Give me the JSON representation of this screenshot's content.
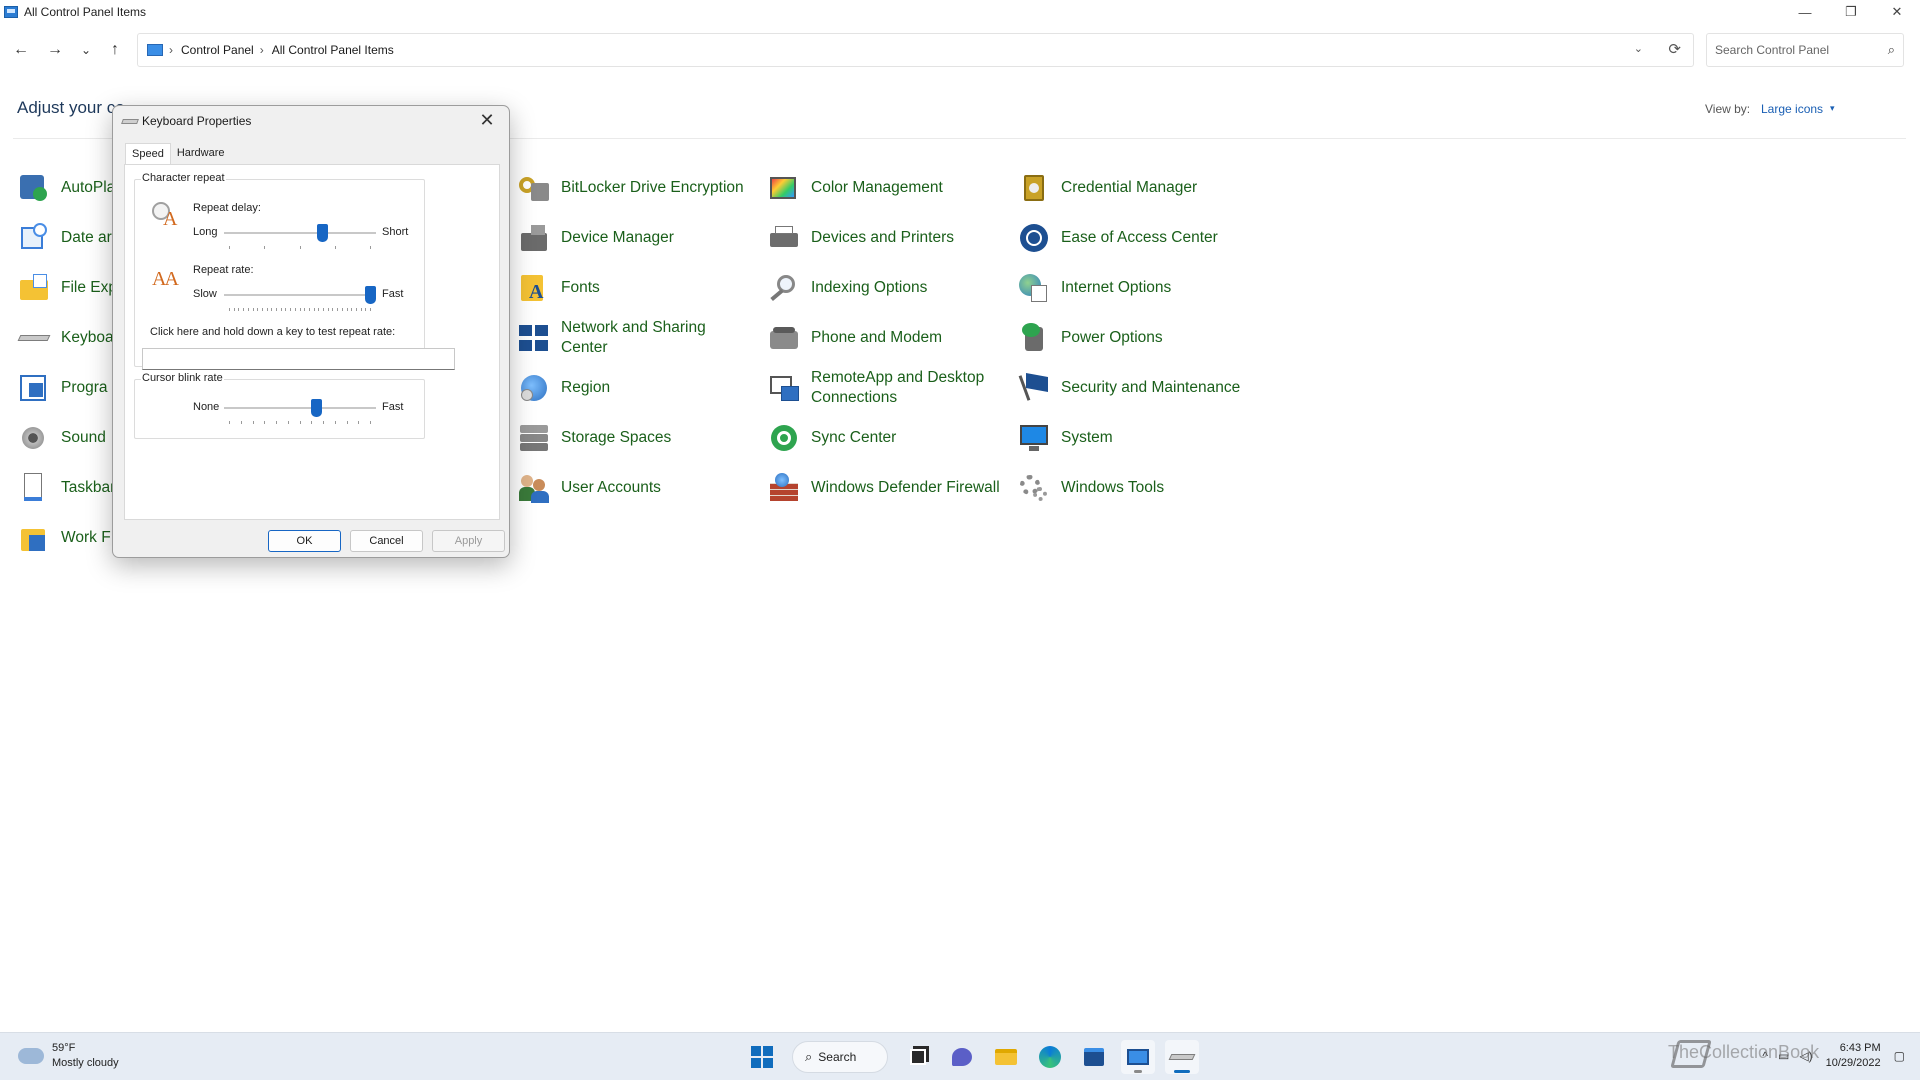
{
  "window": {
    "title": "All Control Panel Items",
    "controls": {
      "minimize": "—",
      "restore": "❐",
      "close": "✕"
    }
  },
  "nav": {
    "back": "←",
    "forward": "→",
    "recent": "⌄",
    "up": "↑",
    "breadcrumb": [
      "Control Panel",
      "All Control Panel Items"
    ],
    "separator": "›",
    "dropdown": "⌄",
    "refresh": "⟳",
    "search_placeholder": "Search Control Panel",
    "search_icon": "⌕"
  },
  "content": {
    "heading": "Adjust your co",
    "view_by_label": "View by:",
    "view_by_value": "Large icons",
    "view_by_caret": "▾",
    "items_col1": [
      {
        "label": "AutoPla",
        "icon": "autoplay-icon"
      },
      {
        "label": "Date ar",
        "icon": "date-time-icon"
      },
      {
        "label": "File Exp",
        "icon": "file-explorer-icon"
      },
      {
        "label": "Keyboa",
        "icon": "keyboard-icon"
      },
      {
        "label": "Progra",
        "icon": "programs-icon"
      },
      {
        "label": "Sound",
        "icon": "sound-icon"
      },
      {
        "label": "Taskbar",
        "icon": "taskbar-icon"
      },
      {
        "label": "Work F",
        "icon": "work-folders-icon"
      }
    ],
    "items_col2": [
      {
        "label": "BitLocker Drive Encryption",
        "icon": "bitlocker-icon"
      },
      {
        "label": "Device Manager",
        "icon": "device-manager-icon"
      },
      {
        "label": "Fonts",
        "icon": "fonts-icon"
      },
      {
        "label": "Network and Sharing Center",
        "icon": "network-icon"
      },
      {
        "label": "Region",
        "icon": "region-icon"
      },
      {
        "label": "Storage Spaces",
        "icon": "storage-spaces-icon"
      },
      {
        "label": "User Accounts",
        "icon": "user-accounts-icon"
      }
    ],
    "items_col3": [
      {
        "label": "Color Management",
        "icon": "color-management-icon"
      },
      {
        "label": "Devices and Printers",
        "icon": "devices-printers-icon"
      },
      {
        "label": "Indexing Options",
        "icon": "indexing-icon"
      },
      {
        "label": "Phone and Modem",
        "icon": "phone-modem-icon"
      },
      {
        "label": "RemoteApp and Desktop Connections",
        "icon": "remoteapp-icon"
      },
      {
        "label": "Sync Center",
        "icon": "sync-center-icon"
      },
      {
        "label": "Windows Defender Firewall",
        "icon": "firewall-icon"
      }
    ],
    "items_col4": [
      {
        "label": "Credential Manager",
        "icon": "credential-manager-icon"
      },
      {
        "label": "Ease of Access Center",
        "icon": "ease-of-access-icon"
      },
      {
        "label": "Internet Options",
        "icon": "internet-options-icon"
      },
      {
        "label": "Power Options",
        "icon": "power-options-icon"
      },
      {
        "label": "Security and Maintenance",
        "icon": "security-flag-icon"
      },
      {
        "label": "System",
        "icon": "system-icon"
      },
      {
        "label": "Windows Tools",
        "icon": "windows-tools-icon"
      }
    ]
  },
  "dialog": {
    "title": "Keyboard Properties",
    "close": "✕",
    "tabs": [
      "Speed",
      "Hardware"
    ],
    "active_tab": "Speed",
    "character_repeat": {
      "group_title": "Character repeat",
      "delay_label": "Repeat delay:",
      "delay_min": "Long",
      "delay_max": "Short",
      "delay_value": 0.66,
      "rate_label": "Repeat rate:",
      "rate_min": "Slow",
      "rate_max": "Fast",
      "rate_value": 1.0,
      "test_label": "Click here and hold down a key to test repeat rate:",
      "test_value": ""
    },
    "cursor_blink": {
      "group_title": "Cursor blink rate",
      "min": "None",
      "max": "Fast",
      "value": 0.62
    },
    "buttons": {
      "ok": "OK",
      "cancel": "Cancel",
      "apply": "Apply"
    }
  },
  "taskbar": {
    "weather_temp": "59°F",
    "weather_desc": "Mostly cloudy",
    "search_label": "Search",
    "search_glyph": "⌕",
    "apps": [
      "windows-start-icon",
      "task-view-icon",
      "teams-chat-icon",
      "file-explorer-icon",
      "edge-icon",
      "store-icon",
      "control-panel-icon",
      "keyboard-app-icon"
    ],
    "tray_chevron": "^",
    "tray_network": "▭",
    "tray_volume": "◁)",
    "time": "6:43 PM",
    "date": "10/29/2022",
    "notification": "▢"
  },
  "watermark": "TheCollectionBook",
  "colors": {
    "link_green": "#1a5f1a",
    "accent_blue": "#1766c4",
    "heading_blue": "#1e395b",
    "taskbar_bg": "#e6ecf4"
  }
}
